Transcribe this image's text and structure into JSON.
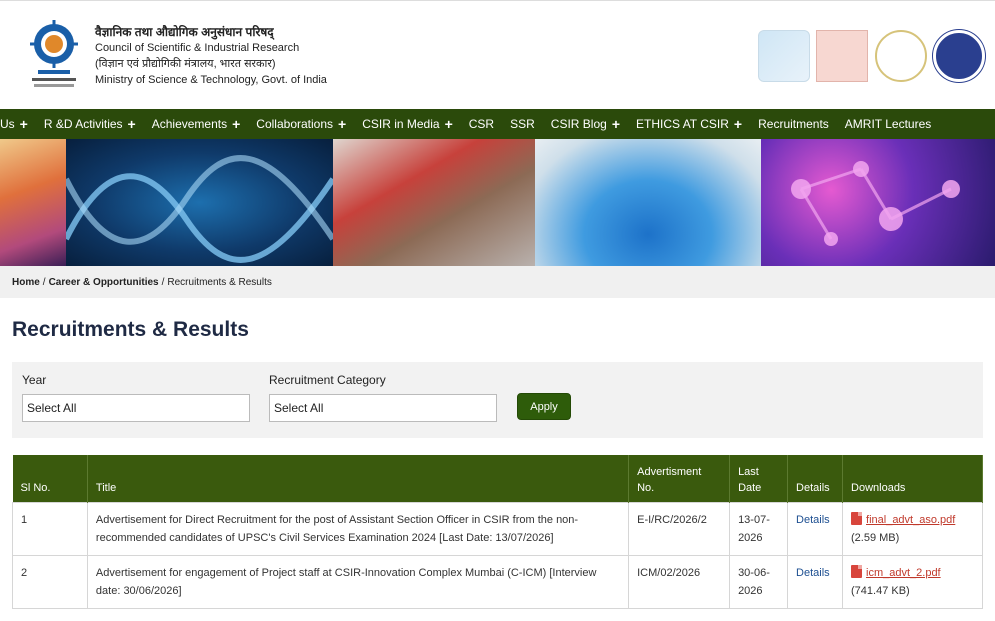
{
  "org": {
    "hindi_name": "वैज्ञानिक तथा औद्योगिक अनुसंधान परिषद्",
    "english_name": "Council of Scientific & Industrial Research",
    "ministry_hindi": "(विज्ञान एवं प्रौद्योगिकी मंत्रालय, भारत सरकार)",
    "ministry": "Ministry of Science & Technology, Govt. of India"
  },
  "nav": [
    {
      "label": "Us",
      "has_plus": true
    },
    {
      "label": "R &D Activities",
      "has_plus": true
    },
    {
      "label": "Achievements",
      "has_plus": true
    },
    {
      "label": "Collaborations",
      "has_plus": true
    },
    {
      "label": "CSIR in Media",
      "has_plus": true
    },
    {
      "label": "CSR",
      "has_plus": false
    },
    {
      "label": "SSR",
      "has_plus": false
    },
    {
      "label": "CSIR Blog",
      "has_plus": true
    },
    {
      "label": "ETHICS AT CSIR",
      "has_plus": true
    },
    {
      "label": "Recruitments",
      "has_plus": false
    },
    {
      "label": "AMRIT Lectures",
      "has_plus": false
    }
  ],
  "breadcrumb": {
    "home": "Home",
    "career": "Career & Opportunities",
    "current": "Recruitments & Results",
    "sep": "/"
  },
  "page_title": "Recruitments & Results",
  "filters": {
    "year_label": "Year",
    "year_value": "Select All",
    "category_label": "Recruitment Category",
    "category_value": "Select All",
    "apply_label": "Apply"
  },
  "table": {
    "headers": [
      "Sl No.",
      "Title",
      "Advertisment No.",
      "Last Date",
      "Details",
      "Downloads"
    ],
    "rows": [
      {
        "sl": "1",
        "title": "Advertisement for Direct Recruitment for the post of Assistant Section Officer in CSIR from the non-recommended candidates of UPSC's Civil Services Examination 2024 [Last Date: 13/07/2026]",
        "adv_no": "E-I/RC/2026/2",
        "last_date": "13-07-2026",
        "details": "Details",
        "file": "final_advt_aso.pdf",
        "size": "(2.59 MB)"
      },
      {
        "sl": "2",
        "title": "Advertisement for engagement of Project staff at CSIR-Innovation Complex Mumbai (C-ICM) [Interview date: 30/06/2026]",
        "adv_no": "ICM/02/2026",
        "last_date": "30-06-2026",
        "details": "Details",
        "file": "icm_advt_2.pdf",
        "size": "(741.47 KB)"
      }
    ]
  },
  "colors": {
    "nav_bg": "#2b4a0b",
    "table_header_bg": "#3a5a0d",
    "apply_bg": "#2e5c0a",
    "title_color": "#1f2a44",
    "link_red": "#c0392b"
  }
}
